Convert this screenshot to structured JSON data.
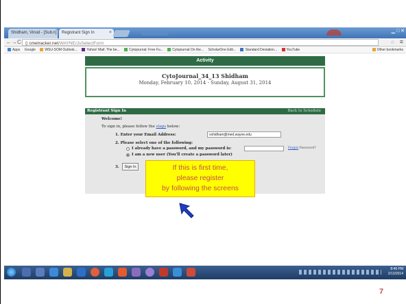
{
  "browser": {
    "tabs": [
      {
        "label": "Shidham, Vinod - [Sub...]"
      },
      {
        "label": "Registrant Sign In"
      }
    ],
    "url_host": "cmetracker.net",
    "url_path": "/WAYNE/JsSelectForm",
    "bookmarks": [
      "Apps",
      "Google",
      "WSU-SOM Outlook...",
      "Yahoo! Mail: The be...",
      "Cytojournal: Free Fu...",
      "Cytojournal On the...",
      "ScholarOne Edit...",
      "Standard Deviation...",
      "YouTube",
      "Other bookmarks"
    ]
  },
  "page": {
    "activity_header": "Activity",
    "activity_title": "CytoJournal_34_13 Shidham",
    "activity_dates": "Monday, February 10, 2014 - Sunday, August 31, 2014",
    "signin_header": "Registrant Sign In",
    "back_link": "Back to Schedule",
    "welcome": "Welcome!",
    "instructions_prefix": "To sign in, please follow the",
    "instructions_link": "steps",
    "instructions_suffix": "below:",
    "step1_label": "1. Enter your Email Address:",
    "email_value": "vshidham@med.wayne.edu",
    "step2_label": "2. Please select one of the following:",
    "option_existing": "I already have a password, and my password is:",
    "forgot_link": "Forgot",
    "forgot_suffix": "Password?",
    "option_new": "I am a new user (You'll create a password later)",
    "step3_label": "3.",
    "signin_button": "Sign In"
  },
  "callout": {
    "line1": "If this is first time,",
    "line2": "please register",
    "line3": "by following the screens",
    "bg_color": "#ffff00",
    "text_color": "#c0504d"
  },
  "taskbar": {
    "clock_time": "8:46 PM",
    "clock_date": "2/12/2014"
  },
  "slide_number": "7"
}
